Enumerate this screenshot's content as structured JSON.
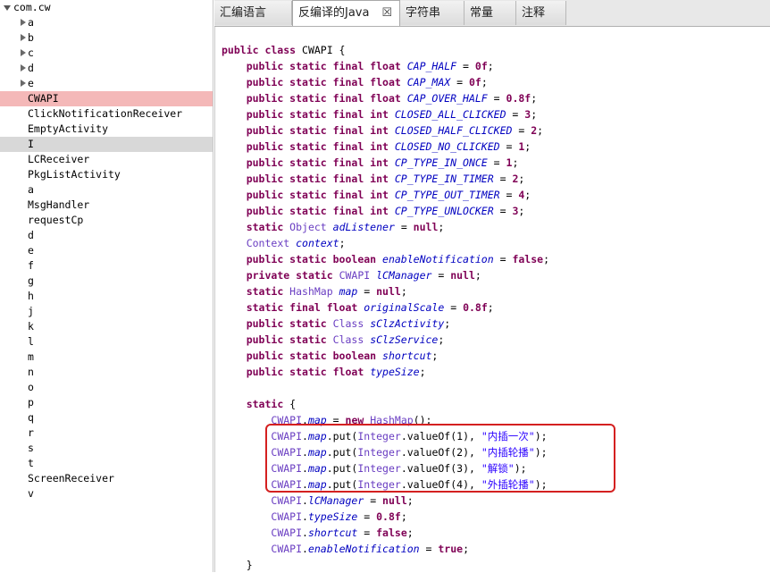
{
  "tree": {
    "root": "com.cw",
    "items": [
      {
        "label": "a",
        "collapsed": true
      },
      {
        "label": "b",
        "collapsed": true
      },
      {
        "label": "c",
        "collapsed": true
      },
      {
        "label": "d",
        "collapsed": true
      },
      {
        "label": "e",
        "collapsed": true
      },
      {
        "label": "CWAPI",
        "selected": "red"
      },
      {
        "label": "ClickNotificationReceiver"
      },
      {
        "label": "EmptyActivity"
      },
      {
        "label": "I",
        "selected": "gray"
      },
      {
        "label": "LCReceiver"
      },
      {
        "label": "PkgListActivity"
      },
      {
        "label": "a"
      },
      {
        "label": "MsgHandler"
      },
      {
        "label": "requestCp"
      },
      {
        "label": "d"
      },
      {
        "label": "e"
      },
      {
        "label": "f"
      },
      {
        "label": "g"
      },
      {
        "label": "h"
      },
      {
        "label": "j"
      },
      {
        "label": "k"
      },
      {
        "label": "l"
      },
      {
        "label": "m"
      },
      {
        "label": "n"
      },
      {
        "label": "o"
      },
      {
        "label": "p"
      },
      {
        "label": "q"
      },
      {
        "label": "r"
      },
      {
        "label": "s"
      },
      {
        "label": "t"
      },
      {
        "label": "ScreenReceiver"
      },
      {
        "label": "v"
      }
    ]
  },
  "tabs": [
    {
      "label": "汇编语言"
    },
    {
      "label": "反编译的Java",
      "active": true,
      "close": "☒"
    },
    {
      "label": "字符串"
    },
    {
      "label": "常量"
    },
    {
      "label": "注释"
    }
  ],
  "code": [
    [
      [
        "kw",
        "public class "
      ],
      [
        "",
        "CWAPI {"
      ]
    ],
    [
      [
        "",
        "    "
      ],
      [
        "kw",
        "public static final float "
      ],
      [
        "fi",
        "CAP_HALF"
      ],
      [
        "",
        " = "
      ],
      [
        "kw",
        "0f"
      ],
      [
        "",
        ";"
      ]
    ],
    [
      [
        "",
        "    "
      ],
      [
        "kw",
        "public static final float "
      ],
      [
        "fi",
        "CAP_MAX"
      ],
      [
        "",
        " = "
      ],
      [
        "kw",
        "0f"
      ],
      [
        "",
        ";"
      ]
    ],
    [
      [
        "",
        "    "
      ],
      [
        "kw",
        "public static final float "
      ],
      [
        "fi",
        "CAP_OVER_HALF"
      ],
      [
        "",
        " = "
      ],
      [
        "kw",
        "0.8f"
      ],
      [
        "",
        ";"
      ]
    ],
    [
      [
        "",
        "    "
      ],
      [
        "kw",
        "public static final int "
      ],
      [
        "fi",
        "CLOSED_ALL_CLICKED"
      ],
      [
        "",
        " = "
      ],
      [
        "kw",
        "3"
      ],
      [
        "",
        ";"
      ]
    ],
    [
      [
        "",
        "    "
      ],
      [
        "kw",
        "public static final int "
      ],
      [
        "fi",
        "CLOSED_HALF_CLICKED"
      ],
      [
        "",
        " = "
      ],
      [
        "kw",
        "2"
      ],
      [
        "",
        ";"
      ]
    ],
    [
      [
        "",
        "    "
      ],
      [
        "kw",
        "public static final int "
      ],
      [
        "fi",
        "CLOSED_NO_CLICKED"
      ],
      [
        "",
        " = "
      ],
      [
        "kw",
        "1"
      ],
      [
        "",
        ";"
      ]
    ],
    [
      [
        "",
        "    "
      ],
      [
        "kw",
        "public static final int "
      ],
      [
        "fi",
        "CP_TYPE_IN_ONCE"
      ],
      [
        "",
        " = "
      ],
      [
        "kw",
        "1"
      ],
      [
        "",
        ";"
      ]
    ],
    [
      [
        "",
        "    "
      ],
      [
        "kw",
        "public static final int "
      ],
      [
        "fi",
        "CP_TYPE_IN_TIMER"
      ],
      [
        "",
        " = "
      ],
      [
        "kw",
        "2"
      ],
      [
        "",
        ";"
      ]
    ],
    [
      [
        "",
        "    "
      ],
      [
        "kw",
        "public static final int "
      ],
      [
        "fi",
        "CP_TYPE_OUT_TIMER"
      ],
      [
        "",
        " = "
      ],
      [
        "kw",
        "4"
      ],
      [
        "",
        ";"
      ]
    ],
    [
      [
        "",
        "    "
      ],
      [
        "kw",
        "public static final int "
      ],
      [
        "fi",
        "CP_TYPE_UNLOCKER"
      ],
      [
        "",
        " = "
      ],
      [
        "kw",
        "3"
      ],
      [
        "",
        ";"
      ]
    ],
    [
      [
        "",
        "    "
      ],
      [
        "kw",
        "static "
      ],
      [
        "ty",
        "Object "
      ],
      [
        "fi",
        "adListener"
      ],
      [
        "",
        " = "
      ],
      [
        "kw",
        "null"
      ],
      [
        "",
        ";"
      ]
    ],
    [
      [
        "",
        "    "
      ],
      [
        "ty",
        "Context "
      ],
      [
        "fi",
        "context"
      ],
      [
        "",
        ";"
      ]
    ],
    [
      [
        "",
        "    "
      ],
      [
        "kw",
        "public static boolean "
      ],
      [
        "fi",
        "enableNotification"
      ],
      [
        "",
        " = "
      ],
      [
        "kw",
        "false"
      ],
      [
        "",
        ";"
      ]
    ],
    [
      [
        "",
        "    "
      ],
      [
        "kw",
        "private static "
      ],
      [
        "ty",
        "CWAPI "
      ],
      [
        "fi",
        "lCManager"
      ],
      [
        "",
        " = "
      ],
      [
        "kw",
        "null"
      ],
      [
        "",
        ";"
      ]
    ],
    [
      [
        "",
        "    "
      ],
      [
        "kw",
        "static "
      ],
      [
        "ty",
        "HashMap "
      ],
      [
        "fi",
        "map"
      ],
      [
        "",
        " = "
      ],
      [
        "kw",
        "null"
      ],
      [
        "",
        ";"
      ]
    ],
    [
      [
        "",
        "    "
      ],
      [
        "kw",
        "static final float "
      ],
      [
        "fi",
        "originalScale"
      ],
      [
        "",
        " = "
      ],
      [
        "kw",
        "0.8f"
      ],
      [
        "",
        ";"
      ]
    ],
    [
      [
        "",
        "    "
      ],
      [
        "kw",
        "public static "
      ],
      [
        "ty",
        "Class "
      ],
      [
        "fi",
        "sClzActivity"
      ],
      [
        "",
        ";"
      ]
    ],
    [
      [
        "",
        "    "
      ],
      [
        "kw",
        "public static "
      ],
      [
        "ty",
        "Class "
      ],
      [
        "fi",
        "sClzService"
      ],
      [
        "",
        ";"
      ]
    ],
    [
      [
        "",
        "    "
      ],
      [
        "kw",
        "public static boolean "
      ],
      [
        "fi",
        "shortcut"
      ],
      [
        "",
        ";"
      ]
    ],
    [
      [
        "",
        "    "
      ],
      [
        "kw",
        "public static float "
      ],
      [
        "fi",
        "typeSize"
      ],
      [
        "",
        ";"
      ]
    ],
    [
      [
        "",
        ""
      ]
    ],
    [
      [
        "",
        "    "
      ],
      [
        "kw",
        "static "
      ],
      [
        "",
        "{"
      ]
    ],
    [
      [
        "",
        "        "
      ],
      [
        "ty",
        "CWAPI"
      ],
      [
        "",
        "."
      ],
      [
        "fi",
        "map"
      ],
      [
        "",
        " = "
      ],
      [
        "kw",
        "new "
      ],
      [
        "ty",
        "HashMap"
      ],
      [
        "",
        "();"
      ]
    ],
    [
      [
        "",
        "        "
      ],
      [
        "ty",
        "CWAPI"
      ],
      [
        "",
        "."
      ],
      [
        "fi",
        "map"
      ],
      [
        "",
        ".put("
      ],
      [
        "ty",
        "Integer"
      ],
      [
        "",
        ".valueOf(1), "
      ],
      [
        "str",
        "\"内插一次\""
      ],
      [
        "",
        ");"
      ]
    ],
    [
      [
        "",
        "        "
      ],
      [
        "ty",
        "CWAPI"
      ],
      [
        "",
        "."
      ],
      [
        "fi",
        "map"
      ],
      [
        "",
        ".put("
      ],
      [
        "ty",
        "Integer"
      ],
      [
        "",
        ".valueOf(2), "
      ],
      [
        "str",
        "\"内插轮播\""
      ],
      [
        "",
        ");"
      ]
    ],
    [
      [
        "",
        "        "
      ],
      [
        "ty",
        "CWAPI"
      ],
      [
        "",
        "."
      ],
      [
        "fi",
        "map"
      ],
      [
        "",
        ".put("
      ],
      [
        "ty",
        "Integer"
      ],
      [
        "",
        ".valueOf(3), "
      ],
      [
        "str",
        "\"解锁\""
      ],
      [
        "",
        ");"
      ]
    ],
    [
      [
        "",
        "        "
      ],
      [
        "ty",
        "CWAPI"
      ],
      [
        "",
        "."
      ],
      [
        "fi",
        "map"
      ],
      [
        "",
        ".put("
      ],
      [
        "ty",
        "Integer"
      ],
      [
        "",
        ".valueOf(4), "
      ],
      [
        "str",
        "\"外插轮播\""
      ],
      [
        "",
        ");"
      ]
    ],
    [
      [
        "",
        "        "
      ],
      [
        "ty",
        "CWAPI"
      ],
      [
        "",
        "."
      ],
      [
        "fi",
        "lCManager"
      ],
      [
        "",
        " = "
      ],
      [
        "kw",
        "null"
      ],
      [
        "",
        ";"
      ]
    ],
    [
      [
        "",
        "        "
      ],
      [
        "ty",
        "CWAPI"
      ],
      [
        "",
        "."
      ],
      [
        "fi",
        "typeSize"
      ],
      [
        "",
        " = "
      ],
      [
        "kw",
        "0.8f"
      ],
      [
        "",
        ";"
      ]
    ],
    [
      [
        "",
        "        "
      ],
      [
        "ty",
        "CWAPI"
      ],
      [
        "",
        "."
      ],
      [
        "fi",
        "shortcut"
      ],
      [
        "",
        " = "
      ],
      [
        "kw",
        "false"
      ],
      [
        "",
        ";"
      ]
    ],
    [
      [
        "",
        "        "
      ],
      [
        "ty",
        "CWAPI"
      ],
      [
        "",
        "."
      ],
      [
        "fi",
        "enableNotification"
      ],
      [
        "",
        " = "
      ],
      [
        "kw",
        "true"
      ],
      [
        "",
        ";"
      ]
    ],
    [
      [
        "",
        "    }"
      ]
    ]
  ],
  "colors": {
    "keyword": "#7f0055",
    "type": "#6a3ec2",
    "field": "#0000c0",
    "string": "#2a00ff",
    "highlight_box": "#d42020",
    "selected_row": "#f4b8b8"
  }
}
